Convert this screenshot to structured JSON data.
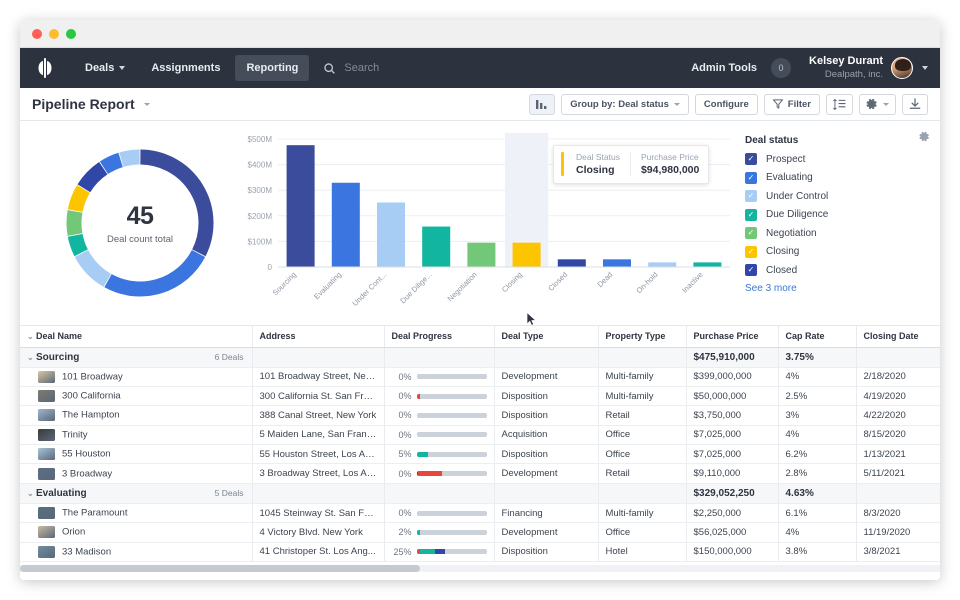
{
  "window": {
    "dots": [
      "close",
      "minimize",
      "zoom"
    ]
  },
  "nav": {
    "logo": "dealpath-logo-icon",
    "items": [
      {
        "label": "Deals",
        "active": false,
        "caret": true
      },
      {
        "label": "Assignments",
        "active": false,
        "caret": false
      },
      {
        "label": "Reporting",
        "active": true,
        "caret": false
      }
    ],
    "search_placeholder": "Search",
    "admin_tools": "Admin Tools",
    "notification_count": "0",
    "user_name": "Kelsey Durant",
    "user_company": "Dealpath, inc."
  },
  "toolbar": {
    "report_title": "Pipeline Report",
    "chart_toggle": "chart-icon",
    "group_by": "Group by: Deal status",
    "configure": "Configure",
    "filter": "Filter",
    "rows_icon": "row-height-icon",
    "settings_icon": "gear-icon",
    "download_icon": "download-icon"
  },
  "donut": {
    "total": "45",
    "caption": "Deal count total"
  },
  "tooltip": {
    "status_key": "Deal Status",
    "status_value": "Closing",
    "price_key": "Purchase Price",
    "price_value": "$94,980,000",
    "accent": "#fdc500"
  },
  "legend": {
    "title": "Deal status",
    "items": [
      {
        "label": "Prospect",
        "color": "#3b4c9c"
      },
      {
        "label": "Evaluating",
        "color": "#3b76e0"
      },
      {
        "label": "Under Control",
        "color": "#a8cdf5"
      },
      {
        "label": "Due Diligence",
        "color": "#12b5a0"
      },
      {
        "label": "Negotiation",
        "color": "#72c878"
      },
      {
        "label": "Closing",
        "color": "#fdc500"
      },
      {
        "label": "Closed",
        "color": "#3147a8"
      }
    ],
    "more_link": "See 3 more",
    "gear_icon": "gear-icon"
  },
  "chart_data": {
    "type": "bar",
    "title": "",
    "xlabel": "",
    "ylabel": "",
    "ylim": [
      0,
      500
    ],
    "unit": "M",
    "ytick_labels": [
      "$500M",
      "$400M",
      "$300M",
      "$200M",
      "$100M",
      "0"
    ],
    "ytick_values": [
      500,
      400,
      300,
      200,
      100,
      0
    ],
    "grid": true,
    "categories": [
      "Sourcing",
      "Evaluating",
      "Under Cont...",
      "Due Dilige...",
      "Negotiation",
      "Closing",
      "Closed",
      "Dead",
      "On-hold",
      "Inactive"
    ],
    "values": [
      475.91,
      329.05,
      252.0,
      158.0,
      95.0,
      94.98,
      30.0,
      30.0,
      18.0,
      18.0
    ],
    "colors": [
      "#3b4c9c",
      "#3b76e0",
      "#a8cdf5",
      "#12b5a0",
      "#72c878",
      "#fdc500",
      "#3147a8",
      "#3b76e0",
      "#a8cdf5",
      "#12b5a0"
    ],
    "highlighted_category": "Closing",
    "donut": {
      "type": "pie",
      "center_value": "45",
      "center_label": "Deal count total",
      "segments": [
        {
          "label": "Prospect",
          "color": "#3b4c9c",
          "value": 14
        },
        {
          "label": "Evaluating",
          "color": "#3b76e0",
          "value": 11
        },
        {
          "label": "Under Control",
          "color": "#a8cdf5",
          "value": 4
        },
        {
          "label": "Due Diligence",
          "color": "#12b5a0",
          "value": 2
        },
        {
          "label": "Negotiation",
          "color": "#72c878",
          "value": 2.5
        },
        {
          "label": "Closing",
          "color": "#fdc500",
          "value": 2.5
        },
        {
          "label": "Closed",
          "color": "#3147a8",
          "value": 3
        },
        {
          "label": "Dead",
          "color": "#3b76e0",
          "value": 2
        },
        {
          "label": "On-hold",
          "color": "#a8cdf5",
          "value": 2
        }
      ]
    }
  },
  "table": {
    "columns": [
      "Deal Name",
      "Address",
      "Deal Progress",
      "Deal Type",
      "Property Type",
      "Purchase Price",
      "Cap Rate",
      "Closing Date"
    ],
    "groups": [
      {
        "name": "Sourcing",
        "count": "6 Deals",
        "total_price": "$475,910,000",
        "total_cap": "3.75%",
        "rows": [
          {
            "thumb": "#d8c7a3",
            "name": "101 Broadway",
            "address": "101 Broadway Street, New...",
            "pct": "0%",
            "segs": [],
            "type": "Development",
            "property": "Multi-family",
            "price": "$399,000,000",
            "cap": "4%",
            "date": "2/18/2020"
          },
          {
            "thumb": "#7e7a70",
            "name": "300 California",
            "address": "300 California St. San Fran..",
            "pct": "0%",
            "segs": [
              {
                "color": "#e8453c",
                "w": 5
              }
            ],
            "type": "Disposition",
            "property": "Multi-family",
            "price": "$50,000,000",
            "cap": "2.5%",
            "date": "4/19/2020"
          },
          {
            "thumb": "#9fb6cc",
            "name": "The Hampton",
            "address": "388 Canal Street, New York",
            "pct": "0%",
            "segs": [],
            "type": "Disposition",
            "property": "Retail",
            "price": "$3,750,000",
            "cap": "3%",
            "date": "4/22/2020"
          },
          {
            "thumb": "#3a3a3a",
            "name": "Trinity",
            "address": "5 Maiden Lane, San Franc...",
            "pct": "0%",
            "segs": [],
            "type": "Acquisition",
            "property": "Office",
            "price": "$7,025,000",
            "cap": "4%",
            "date": "8/15/2020"
          },
          {
            "thumb": "#a8c4d8",
            "name": "55 Houston",
            "address": "55 Houston Street, Los An...",
            "pct": "5%",
            "segs": [
              {
                "color": "#12b5a0",
                "w": 17
              }
            ],
            "type": "Disposition",
            "property": "Office",
            "price": "$7,025,000",
            "cap": "6.2%",
            "date": "1/13/2021"
          },
          {
            "thumb": "#5c6d86",
            "name": "3 Broadway",
            "address": "3 Broadway Street, Los An...",
            "pct": "0%",
            "segs": [
              {
                "color": "#3147a8",
                "w": 2
              },
              {
                "color": "#e8453c",
                "w": 35
              }
            ],
            "type": "Development",
            "property": "Retail",
            "price": "$9,110,000",
            "cap": "2.8%",
            "date": "5/11/2021"
          }
        ]
      },
      {
        "name": "Evaluating",
        "count": "5 Deals",
        "total_price": "$329,052,250",
        "total_cap": "4.63%",
        "rows": [
          {
            "thumb": "#54707f",
            "name": "The Paramount",
            "address": "1045 Steinway St. San Fra...",
            "pct": "0%",
            "segs": [],
            "type": "Financing",
            "property": "Multi-family",
            "price": "$2,250,000",
            "cap": "6.1%",
            "date": "8/3/2020"
          },
          {
            "thumb": "#c9b9a2",
            "name": "Orion",
            "address": "4 Victory Blvd. New York",
            "pct": "2%",
            "segs": [
              {
                "color": "#12b5a0",
                "w": 5
              }
            ],
            "type": "Development",
            "property": "Office",
            "price": "$56,025,000",
            "cap": "4%",
            "date": "11/19/2020"
          },
          {
            "thumb": "#6f8ea0",
            "name": "33 Madison",
            "address": "41 Christoper St. Los Ang...",
            "pct": "25%",
            "segs": [
              {
                "color": "#e8453c",
                "w": 5
              },
              {
                "color": "#12b5a0",
                "w": 22
              },
              {
                "color": "#3147a8",
                "w": 14
              }
            ],
            "type": "Disposition",
            "property": "Hotel",
            "price": "$150,000,000",
            "cap": "3.8%",
            "date": "3/8/2021"
          }
        ]
      }
    ]
  }
}
